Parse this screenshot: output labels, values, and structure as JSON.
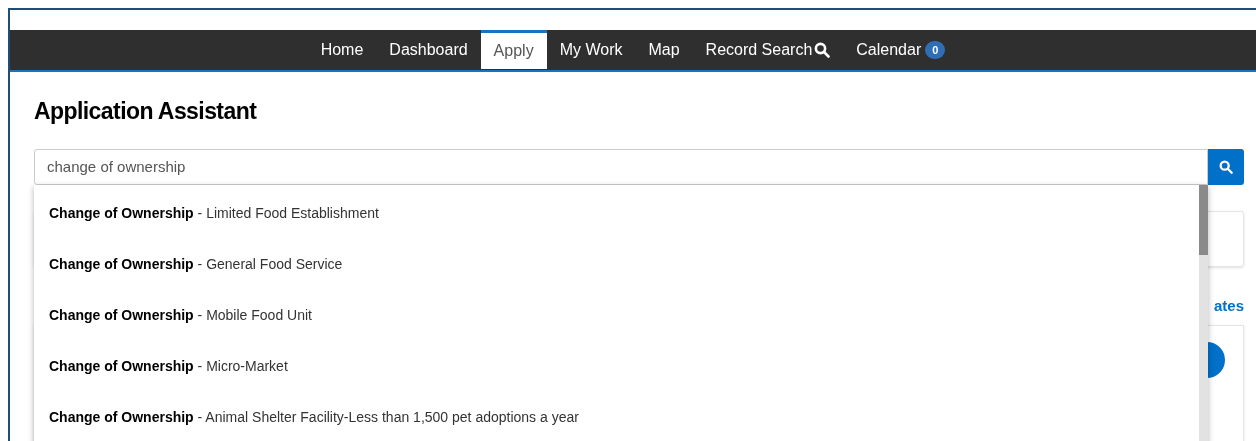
{
  "nav": [
    {
      "label": "Home",
      "selected": false
    },
    {
      "label": "Dashboard",
      "selected": false
    },
    {
      "label": "Apply",
      "selected": true
    },
    {
      "label": "My Work",
      "selected": false
    },
    {
      "label": "Map",
      "selected": false
    },
    {
      "label": "Record Search",
      "selected": false,
      "kind": "search"
    },
    {
      "label": "Calendar",
      "selected": false,
      "badge": "0"
    }
  ],
  "title": "Application Assistant",
  "search": {
    "value": "change of ownership"
  },
  "suggestions": [
    {
      "bold": "Change of Ownership",
      "rest": " - Limited Food Establishment"
    },
    {
      "bold": "Change of Ownership",
      "rest": " - General Food Service"
    },
    {
      "bold": "Change of Ownership",
      "rest": " - Mobile Food Unit"
    },
    {
      "bold": "Change of Ownership",
      "rest": " - Micro-Market"
    },
    {
      "bold": "Change of Ownership",
      "rest": " - Animal Shelter Facility-Less than 1,500 pet adoptions a year"
    }
  ],
  "background_link": "ates"
}
